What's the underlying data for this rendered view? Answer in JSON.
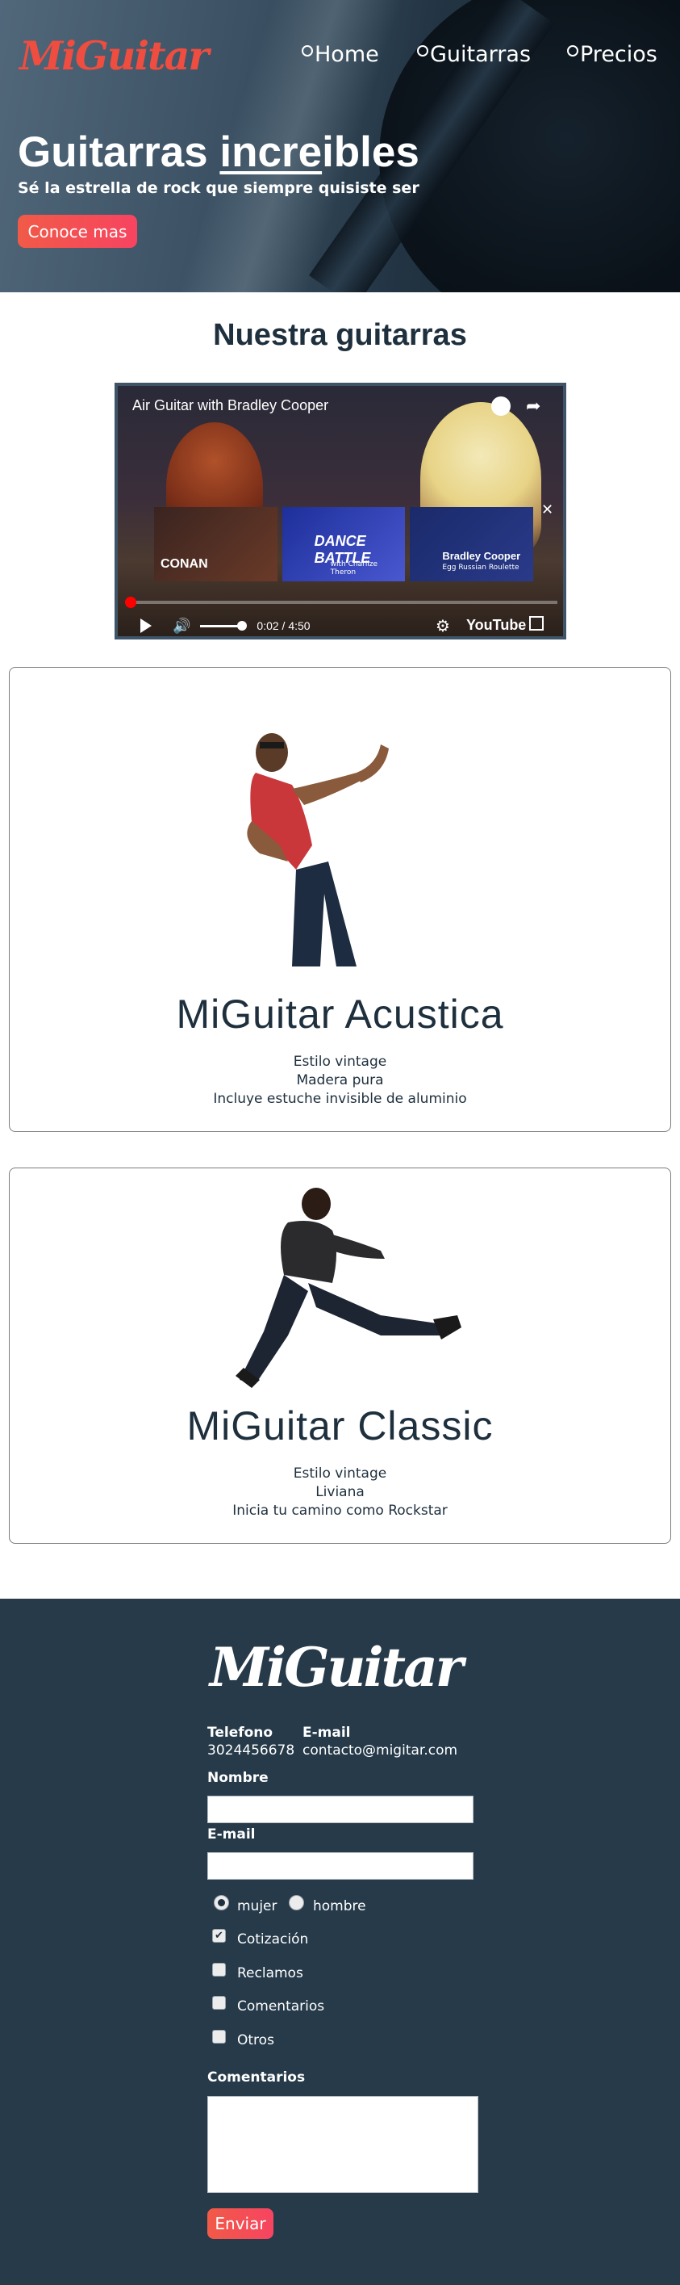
{
  "brand": {
    "logo": "MiGuitar"
  },
  "nav": {
    "items": [
      {
        "label": "Home"
      },
      {
        "label": "Guitarras"
      },
      {
        "label": "Precios"
      }
    ]
  },
  "hero": {
    "title_pre": "Guitarras ",
    "title_underlined": "incre",
    "title_post": "ibles",
    "subtitle": "Sé la estrella de rock que siempre quisiste ser",
    "cta_label": "Conoce mas"
  },
  "section": {
    "title": "Nuestra guitarras"
  },
  "video": {
    "title": "Air Guitar with Bradley Cooper",
    "time": "0:02 / 4:50",
    "platform": "YouTube",
    "progress": 0.01,
    "volume": 1.0,
    "related": [
      {
        "line1": "CONAN",
        "line2": ""
      },
      {
        "line1": "DANCE BATTLE",
        "line2": "with Charlize Theron"
      },
      {
        "line1": "Bradley Cooper",
        "line2": "Egg Russian Roulette"
      }
    ]
  },
  "products": [
    {
      "title": "MiGuitar Acustica",
      "lines": [
        "Estilo vintage",
        "Madera pura",
        "Incluye estuche invisible de aluminio"
      ]
    },
    {
      "title": "MiGuitar Classic",
      "lines": [
        "Estilo vintage",
        "Liviana",
        "Inicia tu camino como Rockstar"
      ]
    }
  ],
  "footer": {
    "logo": "MiGuitar",
    "phone_label": "Telefono",
    "phone_value": "3024456678",
    "email_label": "E-mail",
    "email_value": "contacto@migitar.com",
    "form": {
      "name_label": "Nombre",
      "email_label": "E-mail",
      "name_value": "",
      "email_value": "",
      "gender_options": [
        {
          "label": "mujer",
          "checked": true
        },
        {
          "label": "hombre",
          "checked": false
        }
      ],
      "topics": [
        {
          "label": "Cotización",
          "checked": true
        },
        {
          "label": "Reclamos",
          "checked": false
        },
        {
          "label": "Comentarios",
          "checked": false
        },
        {
          "label": "Otros",
          "checked": false
        }
      ],
      "comments_label": "Comentarios",
      "comments_value": "",
      "submit_label": "Enviar"
    }
  },
  "colors": {
    "accent": "#f15a47",
    "dark": "#1e2f3d",
    "footer_bg": "#263a4a"
  }
}
